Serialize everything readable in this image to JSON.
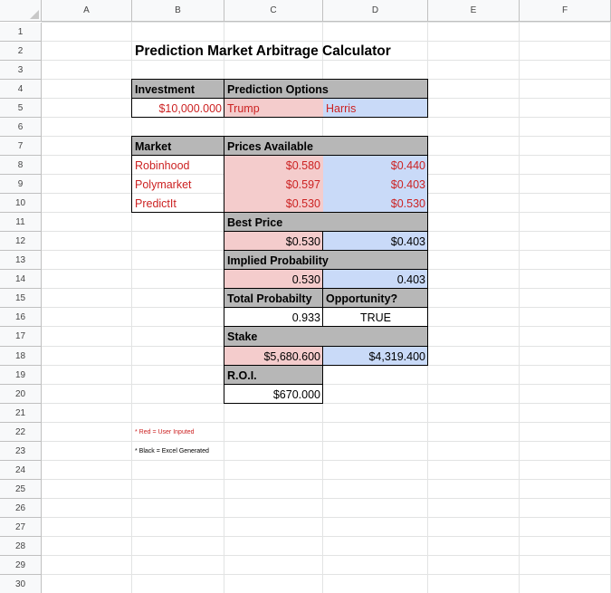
{
  "colors": {
    "header_gray": "#b7b7b7",
    "trump_pink": "#f4cccc",
    "harris_blue": "#c9daf8",
    "user_input_red": "#cc2222"
  },
  "headers": {
    "columns": [
      "A",
      "B",
      "C",
      "D",
      "E",
      "F"
    ],
    "rows": [
      "1",
      "2",
      "3",
      "4",
      "5",
      "6",
      "7",
      "8",
      "9",
      "10",
      "11",
      "12",
      "13",
      "14",
      "15",
      "16",
      "17",
      "18",
      "19",
      "20",
      "21",
      "22",
      "23",
      "24",
      "25",
      "26",
      "27",
      "28",
      "29",
      "30"
    ]
  },
  "sheet": {
    "title": "Prediction Market Arbitrage Calculator",
    "investment_label": "Investment",
    "investment_value": "$10,000.000",
    "options_label": "Prediction Options",
    "option_trump": "Trump",
    "option_harris": "Harris",
    "market_label": "Market",
    "prices_label": "Prices Available",
    "markets": [
      "Robinhood",
      "Polymarket",
      "PredictIt"
    ],
    "prices_trump": [
      "$0.580",
      "$0.597",
      "$0.530"
    ],
    "prices_harris": [
      "$0.440",
      "$0.403",
      "$0.530"
    ],
    "best_price_label": "Best Price",
    "best_trump": "$0.530",
    "best_harris": "$0.403",
    "implied_label": "Implied Probability",
    "implied_trump": "0.530",
    "implied_harris": "0.403",
    "total_prob_label": "Total Probabilty",
    "opportunity_label": "Opportunity?",
    "total_prob_value": "0.933",
    "opportunity_value": "TRUE",
    "stake_label": "Stake",
    "stake_trump": "$5,680.600",
    "stake_harris": "$4,319.400",
    "roi_label": "R.O.I.",
    "roi_value": "$670.000",
    "note_red": "* Red = User Inputed",
    "note_black": "* Black = Excel Generated"
  }
}
